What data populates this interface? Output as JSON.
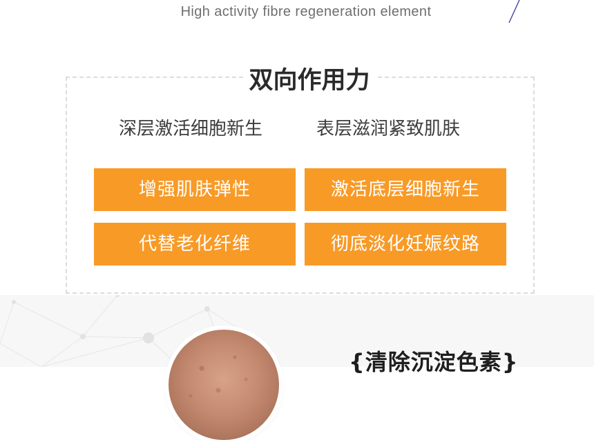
{
  "header": {
    "subtitle": "High activity fibre regeneration element"
  },
  "panel": {
    "title": "双向作用力",
    "features": [
      "深层激活细胞新生",
      "表层滋润紧致肌肤"
    ],
    "benefits": [
      "增强肌肤弹性",
      "激活底层细胞新生",
      "代替老化纤维",
      "彻底淡化妊娠纹路"
    ]
  },
  "next_section": {
    "heading": "{清除沉淀色素}"
  },
  "colors": {
    "accent_orange": "#f89a26",
    "deco_line": "#4b4ba0",
    "panel_border": "#dcdcdc",
    "text_dark": "#2a2a2a",
    "text_gray": "#6e6e6e"
  }
}
